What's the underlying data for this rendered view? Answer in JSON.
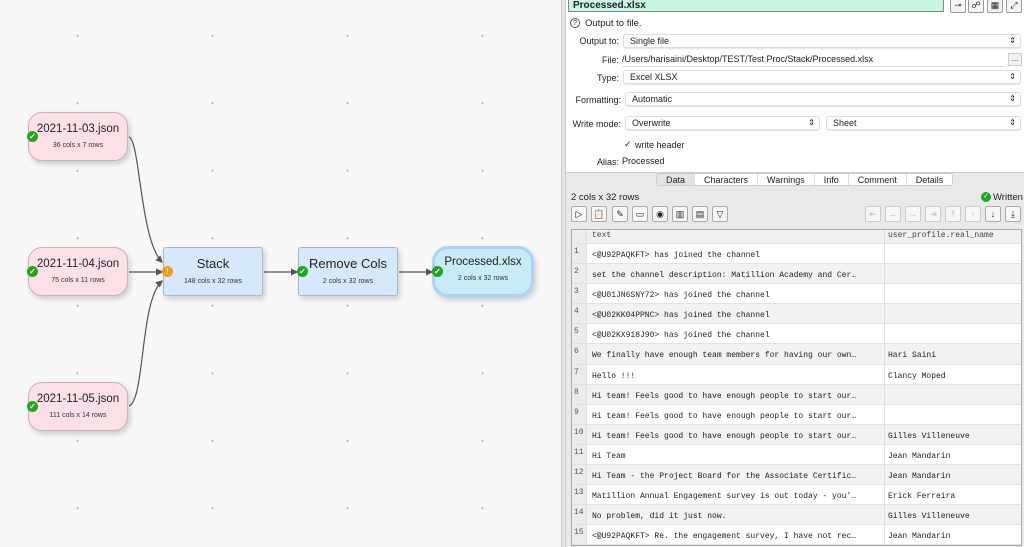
{
  "canvas": {
    "nodes": [
      {
        "id": "in1",
        "title": "2021-11-03.json",
        "info": "36 cols x 7 rows",
        "status": "ok"
      },
      {
        "id": "in2",
        "title": "2021-11-04.json",
        "info": "75 cols x 11 rows",
        "status": "ok"
      },
      {
        "id": "in3",
        "title": "2021-11-05.json",
        "info": "111 cols x 14 rows",
        "status": "ok"
      },
      {
        "id": "stack",
        "title": "Stack",
        "info": "148 cols x 32 rows",
        "status": "warning"
      },
      {
        "id": "remove",
        "title": "Remove Cols",
        "info": "2 cols x 32 rows",
        "status": "ok"
      },
      {
        "id": "out",
        "title": "Processed.xlsx",
        "info": "2 cols x 32 rows",
        "status": "ok"
      }
    ]
  },
  "panel": {
    "title": "Processed.xlsx",
    "help": "Output to file.",
    "output_to": {
      "label": "Output to:",
      "value": "Single file"
    },
    "file": {
      "label": "File:",
      "value": "/Users/harisaini/Desktop/TEST/Test Proc/Stack/Processed.xlsx",
      "browse": "..."
    },
    "type": {
      "label": "Type:",
      "value": "Excel XLSX"
    },
    "formatting": {
      "label": "Formatting:",
      "value": "Automatic"
    },
    "write_mode": {
      "label": "Write mode:",
      "value": "Overwrite",
      "sheet": "Sheet"
    },
    "write_header": {
      "label": "write header",
      "checked": true
    },
    "alias": {
      "label": "Alias:",
      "value": "Processed"
    },
    "tabs": [
      "Data",
      "Characters",
      "Warnings",
      "Info",
      "Comment",
      "Details"
    ],
    "active_tab": "Data",
    "dims": "2 cols x 32 rows",
    "status": "Written",
    "colors": {
      "title_bg": "#c9f6e2",
      "ok": "#1ea61e",
      "warning": "#f39c12"
    }
  },
  "table": {
    "columns": [
      "text",
      "user_profile.real_name"
    ],
    "rows": [
      [
        "1",
        "<@U92PAQKFT> has joined the channel",
        ""
      ],
      [
        "2",
        "set the channel description: Matillion Academy and Cer…",
        ""
      ],
      [
        "3",
        "<@U01JN6SNY72> has joined the channel",
        ""
      ],
      [
        "4",
        "<@U02KK04PPNC> has joined the channel",
        ""
      ],
      [
        "5",
        "<@U02KX918J90> has joined the channel",
        ""
      ],
      [
        "6",
        "We finally have enough team members for having our own…",
        "Hari Saini"
      ],
      [
        "7",
        "Hello !!!",
        "Clancy Moped"
      ],
      [
        "8",
        "Hi team! Feels good to have enough people to start our…",
        ""
      ],
      [
        "9",
        "Hi team! Feels good to have enough people to start our…",
        ""
      ],
      [
        "10",
        "Hi team! Feels good to have enough people to start our…",
        "Gilles Villeneuve"
      ],
      [
        "11",
        "Hi Team",
        "Jean Mandarin"
      ],
      [
        "12",
        "Hi Team - the Project Board for the Associate Certific…",
        "Jean Mandarin"
      ],
      [
        "13",
        "Matillion Annual Engagement survey is out today - you'…",
        "Erick Ferreira"
      ],
      [
        "14",
        "No problem, did it just now.",
        "Gilles Villeneuve"
      ],
      [
        "15",
        "<@U92PAQKFT> Re. the engagement survey, I have not rec…",
        "Jean Mandarin"
      ]
    ]
  }
}
